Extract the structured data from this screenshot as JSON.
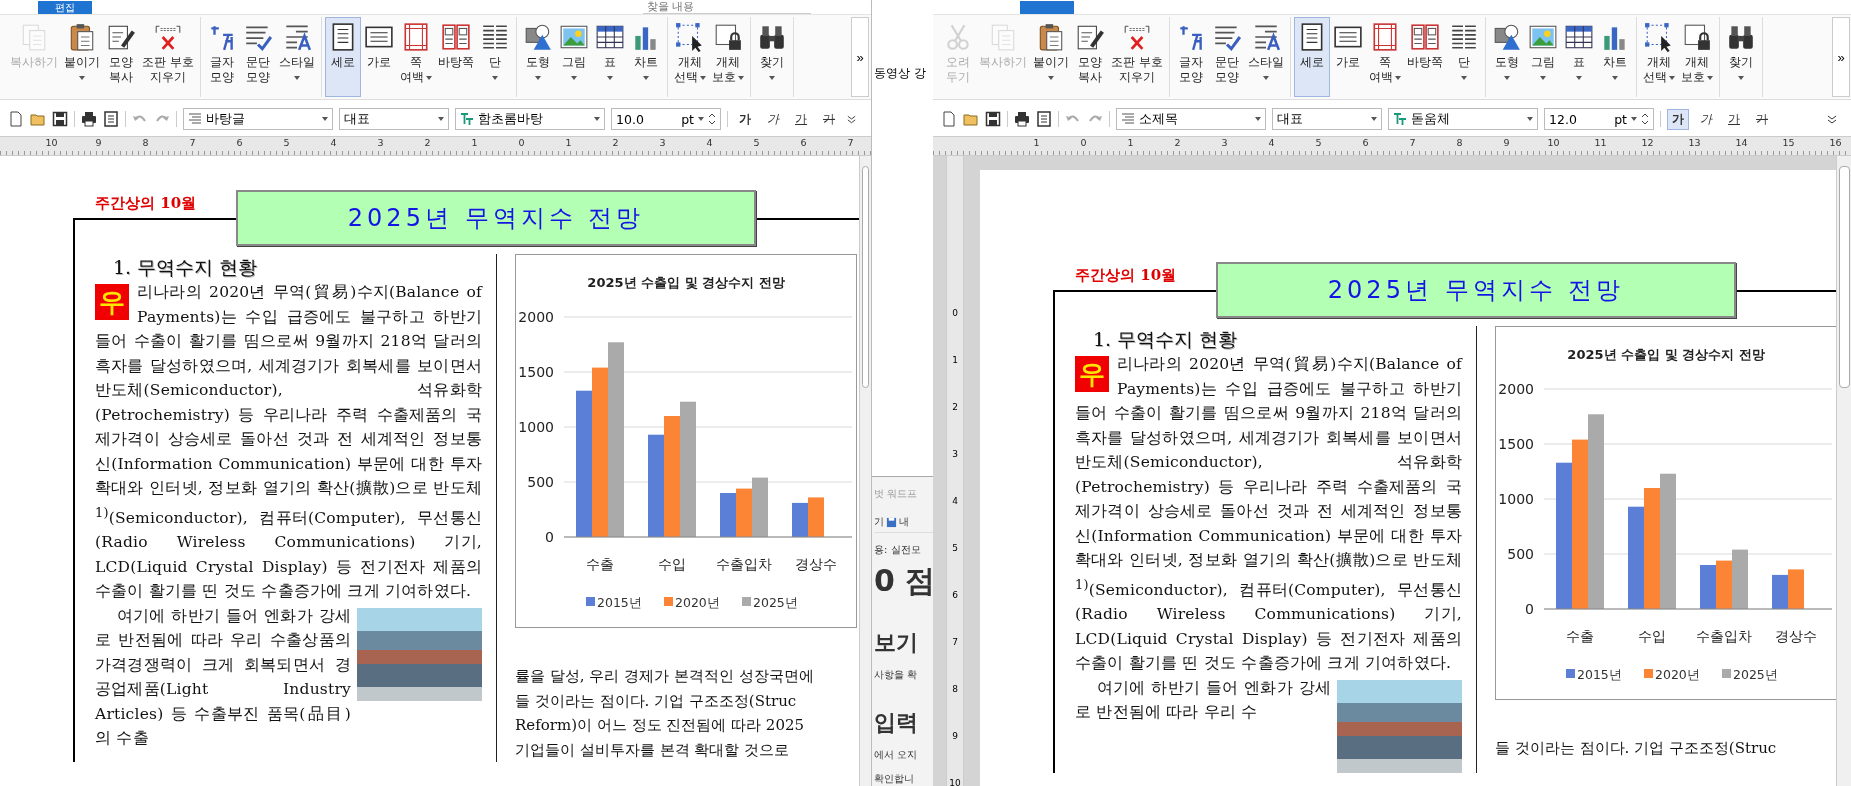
{
  "windows": [
    {
      "menu_tab": "편집",
      "search_placeholder": "찾을 내용",
      "ribbon": [
        [
          {
            "label_lines": [
              "복사하기"
            ],
            "kind": "copy",
            "dropdown": false,
            "disabled": true,
            "selected": false
          },
          {
            "label_lines": [
              "붙이기"
            ],
            "kind": "paste",
            "dropdown": true,
            "disabled": false,
            "selected": false
          },
          {
            "label_lines": [
              "모양",
              "복사"
            ],
            "kind": "painter",
            "dropdown": false,
            "disabled": false,
            "selected": false
          },
          {
            "label_lines": [
              "조판 부호",
              "지우기"
            ],
            "kind": "clear",
            "dropdown": false,
            "disabled": false,
            "selected": false
          }
        ],
        [
          {
            "label_lines": [
              "글자",
              "모양"
            ],
            "kind": "char",
            "dropdown": false,
            "disabled": false,
            "selected": false
          },
          {
            "label_lines": [
              "문단",
              "모양"
            ],
            "kind": "para",
            "dropdown": false,
            "disabled": false,
            "selected": false
          },
          {
            "label_lines": [
              "스타일"
            ],
            "kind": "style",
            "dropdown": true,
            "disabled": false,
            "selected": false
          }
        ],
        [
          {
            "label_lines": [
              "세로"
            ],
            "kind": "portrait",
            "dropdown": false,
            "disabled": false,
            "selected": true
          },
          {
            "label_lines": [
              "가로"
            ],
            "kind": "landscape",
            "dropdown": false,
            "disabled": false,
            "selected": false
          },
          {
            "label_lines": [
              "쪽",
              "여백"
            ],
            "kind": "margin",
            "dropdown": true,
            "disabled": false,
            "selected": false
          },
          {
            "label_lines": [
              "바탕쪽"
            ],
            "kind": "master",
            "dropdown": false,
            "disabled": false,
            "selected": false
          },
          {
            "label_lines": [
              "단"
            ],
            "kind": "columns",
            "dropdown": true,
            "disabled": false,
            "selected": false
          }
        ],
        [
          {
            "label_lines": [
              "도형"
            ],
            "kind": "shape",
            "dropdown": true,
            "disabled": false,
            "selected": false
          },
          {
            "label_lines": [
              "그림"
            ],
            "kind": "picture",
            "dropdown": true,
            "disabled": false,
            "selected": false
          },
          {
            "label_lines": [
              "표"
            ],
            "kind": "table",
            "dropdown": true,
            "disabled": false,
            "selected": false
          },
          {
            "label_lines": [
              "차트"
            ],
            "kind": "chart",
            "dropdown": true,
            "disabled": false,
            "selected": false
          }
        ],
        [
          {
            "label_lines": [
              "개체",
              "선택"
            ],
            "kind": "select",
            "dropdown": true,
            "disabled": false,
            "selected": false
          },
          {
            "label_lines": [
              "개체",
              "보호"
            ],
            "kind": "lock",
            "dropdown": true,
            "disabled": false,
            "selected": false
          }
        ],
        [
          {
            "label_lines": [
              "찾기"
            ],
            "kind": "find",
            "dropdown": true,
            "disabled": false,
            "selected": false
          }
        ]
      ],
      "overflow": "»",
      "toolbar": {
        "style": "바탕글",
        "language": "대표",
        "font": "함초롬바탕",
        "size": "10.0",
        "unit": "pt",
        "format": [
          {
            "glyph": "가",
            "kind": "bold",
            "selected": false
          },
          {
            "glyph": "가",
            "kind": "italic",
            "selected": false
          },
          {
            "glyph": "가",
            "kind": "underline",
            "selected": false
          },
          {
            "glyph": "가",
            "kind": "strike",
            "selected": false
          }
        ]
      },
      "ruler": [
        "10",
        "9",
        "8",
        "7",
        "6",
        "5",
        "4",
        "3",
        "2",
        "1",
        "0",
        "1",
        "2",
        "3",
        "4",
        "5",
        "6",
        "7"
      ],
      "document": {
        "header_label": "주간상의 10월",
        "title": "2025년 무역지수 전망",
        "heading": "1. 무역수지 현황",
        "drop_cap": "우",
        "paragraphs": [
          "리나라의 2020년 무역(貿易)수지(Balance of Payments)는 수입 급증에도 불구하고 하반기 들어 수출이 활기를 띰으로써 9월까지 218억 달러의 흑자를 달성하였으며, 세계경기가 회복세를 보이면서 반도체(Semiconductor), 석유화학(Petrochemistry) 등 우리나라 주력 수출제품의 국제가격이 상승세로 돌아선 것과 전 세계적인 정보통신(Information Communication) 부문에 대한 투자 확대와 인터넷, 정보화 열기의 확산(擴散)으로 반도체$^{1)}$(Semiconductor), 컴퓨터(Computer), 무선통신(Radio Wireless Communications) 기기, LCD(Liquid Crystal Display) 등 전기전자 제품의 수출이 활기를 띤 것도 수출증가에 크게 기여하였다.",
          "여기에 하반기 들어 엔화가 강세로 반전됨에 따라 우리 수출상품의 가격경쟁력이 크게 회복되면서 경공업제품(Light Industry Articles) 등 수출부진 품목(品目)의 수출"
        ],
        "chart_data": {
          "type": "bar",
          "title": "2025년 수출입 및 경상수지 전망",
          "categories": [
            "수출",
            "수입",
            "수출입차",
            "경상수"
          ],
          "series": [
            {
              "name": "2015년",
              "color": "#5b7fd6",
              "values": [
                1330,
                930,
                400,
                310
              ]
            },
            {
              "name": "2020년",
              "color": "#fb8535",
              "values": [
                1540,
                1100,
                440,
                360
              ]
            },
            {
              "name": "2025년",
              "color": "#aaaaaa",
              "values": [
                1770,
                1230,
                540,
                null
              ]
            }
          ],
          "ylim": [
            0,
            2000
          ],
          "yticks": [
            0,
            500,
            1000,
            1500,
            2000
          ],
          "grid": true,
          "legend": "bottom"
        },
        "column2_lines": [
          "률을 달성, 우리 경제가 본격적인 성장국면에",
          "들 것이라는 점이다. 기업 구조조정(Struc",
          "Reform)이 어느 정도 진전됨에 따라 2025",
          "기업들이 설비투자를 본격 확대할 것으로"
        ]
      }
    },
    {
      "ribbon": [
        [
          {
            "label_lines": [
              "오려",
              "두기"
            ],
            "kind": "cut",
            "dropdown": false,
            "disabled": true,
            "selected": false
          },
          {
            "label_lines": [
              "복사하기"
            ],
            "kind": "copy",
            "dropdown": false,
            "disabled": true,
            "selected": false
          },
          {
            "label_lines": [
              "붙이기"
            ],
            "kind": "paste",
            "dropdown": true,
            "disabled": false,
            "selected": false
          },
          {
            "label_lines": [
              "모양",
              "복사"
            ],
            "kind": "painter",
            "dropdown": false,
            "disabled": false,
            "selected": false
          },
          {
            "label_lines": [
              "조판 부호",
              "지우기"
            ],
            "kind": "clear",
            "dropdown": false,
            "disabled": false,
            "selected": false
          }
        ],
        [
          {
            "label_lines": [
              "글자",
              "모양"
            ],
            "kind": "char",
            "dropdown": false,
            "disabled": false,
            "selected": false
          },
          {
            "label_lines": [
              "문단",
              "모양"
            ],
            "kind": "para",
            "dropdown": false,
            "disabled": false,
            "selected": false
          },
          {
            "label_lines": [
              "스타일"
            ],
            "kind": "style",
            "dropdown": true,
            "disabled": false,
            "selected": false
          }
        ],
        [
          {
            "label_lines": [
              "세로"
            ],
            "kind": "portrait",
            "dropdown": false,
            "disabled": false,
            "selected": true
          },
          {
            "label_lines": [
              "가로"
            ],
            "kind": "landscape",
            "dropdown": false,
            "disabled": false,
            "selected": false
          },
          {
            "label_lines": [
              "쪽",
              "여백"
            ],
            "kind": "margin",
            "dropdown": true,
            "disabled": false,
            "selected": false
          },
          {
            "label_lines": [
              "바탕쪽"
            ],
            "kind": "master",
            "dropdown": false,
            "disabled": false,
            "selected": false
          },
          {
            "label_lines": [
              "단"
            ],
            "kind": "columns",
            "dropdown": true,
            "disabled": false,
            "selected": false
          }
        ],
        [
          {
            "label_lines": [
              "도형"
            ],
            "kind": "shape",
            "dropdown": true,
            "disabled": false,
            "selected": false
          },
          {
            "label_lines": [
              "그림"
            ],
            "kind": "picture",
            "dropdown": true,
            "disabled": false,
            "selected": false
          },
          {
            "label_lines": [
              "표"
            ],
            "kind": "table",
            "dropdown": true,
            "disabled": false,
            "selected": false
          },
          {
            "label_lines": [
              "차트"
            ],
            "kind": "chart",
            "dropdown": true,
            "disabled": false,
            "selected": false
          }
        ],
        [
          {
            "label_lines": [
              "개체",
              "선택"
            ],
            "kind": "select",
            "dropdown": true,
            "disabled": false,
            "selected": false
          },
          {
            "label_lines": [
              "개체",
              "보호"
            ],
            "kind": "lock",
            "dropdown": true,
            "disabled": false,
            "selected": false
          }
        ],
        [
          {
            "label_lines": [
              "찾기"
            ],
            "kind": "find",
            "dropdown": true,
            "disabled": false,
            "selected": false
          }
        ]
      ],
      "overflow": "»",
      "toolbar": {
        "style": "소제목",
        "language": "대표",
        "font": "돋움체",
        "size": "12.0",
        "unit": "pt",
        "format": [
          {
            "glyph": "가",
            "kind": "bold",
            "selected": true
          },
          {
            "glyph": "가",
            "kind": "italic",
            "selected": false
          },
          {
            "glyph": "가",
            "kind": "underline",
            "selected": false
          },
          {
            "glyph": "가",
            "kind": "strike",
            "selected": false
          }
        ]
      },
      "ruler": [
        "1",
        "0",
        "1",
        "2",
        "3",
        "4",
        "5",
        "6",
        "7",
        "8",
        "9",
        "10",
        "11",
        "12",
        "13",
        "14",
        "15",
        "16"
      ],
      "vertical_ruler": [
        "0",
        "1",
        "2",
        "3",
        "4",
        "5",
        "6",
        "7",
        "8",
        "9",
        "10"
      ],
      "document": {
        "header_label": "주간상의 10월",
        "title": "2025년 무역지수 전망",
        "heading": "1. 무역수지 현황",
        "drop_cap": "우",
        "paragraphs": [
          "리나라의 2020년 무역(貿易)수지(Balance of Payments)는 수입 급증에도 불구하고 하반기 들어 수출이 활기를 띰으로써 9월까지 218억 달러의 흑자를 달성하였으며, 세계경기가 회복세를 보이면서 반도체(Semiconductor), 석유화학(Petrochemistry) 등 우리나라 주력 수출제품의 국제가격이 상승세로 돌아선 것과 전 세계적인 정보통신(Information Communication) 부문에 대한 투자 확대와 인터넷, 정보화 열기의 확산(擴散)으로 반도체$^{1)}$(Semiconductor), 컴퓨터(Computer), 무선통신(Radio Wireless Communications) 기기, LCD(Liquid Crystal Display) 등 전기전자 제품의 수출이 활기를 띤 것도 수출증가에 크게 기여하였다.",
          "여기에 하반기 들어 엔화가 강세로 반전됨에 따라 우리 수"
        ],
        "chart_data": {
          "type": "bar",
          "title": "2025년 수출입 및 경상수지 전망",
          "categories": [
            "수출",
            "수입",
            "수출입차",
            "경상수"
          ],
          "series": [
            {
              "name": "2015년",
              "color": "#5b7fd6",
              "values": [
                1330,
                930,
                400,
                310
              ]
            },
            {
              "name": "2020년",
              "color": "#fb8535",
              "values": [
                1540,
                1100,
                440,
                360
              ]
            },
            {
              "name": "2025년",
              "color": "#aaaaaa",
              "values": [
                1770,
                1230,
                540,
                null
              ]
            }
          ],
          "ylim": [
            0,
            2000
          ],
          "yticks": [
            0,
            500,
            1000,
            1500,
            2000
          ],
          "grid": true,
          "legend": "bottom"
        },
        "column2_lines": [
          "들 것이라는 점이다. 기업 구조조정(Struc"
        ]
      }
    }
  ],
  "background_window": {
    "top_text": "동영상 강",
    "items": [
      {
        "kind": "title",
        "texts": [
          "벗 워드프"
        ]
      },
      {
        "kind": "toolbar",
        "texts": [
          "기",
          "내"
        ]
      },
      {
        "kind": "text",
        "texts": [
          "용: 실전모"
        ]
      },
      {
        "kind": "big",
        "texts": [
          "0 점"
        ]
      },
      {
        "kind": "heading",
        "texts": [
          "보기"
        ]
      },
      {
        "kind": "text",
        "texts": [
          "사항을 확"
        ]
      },
      {
        "kind": "heading",
        "texts": [
          "입력"
        ]
      },
      {
        "kind": "text",
        "texts": [
          "에서 오지"
        ]
      },
      {
        "kind": "text",
        "texts": [
          "확인합니"
        ]
      }
    ]
  }
}
